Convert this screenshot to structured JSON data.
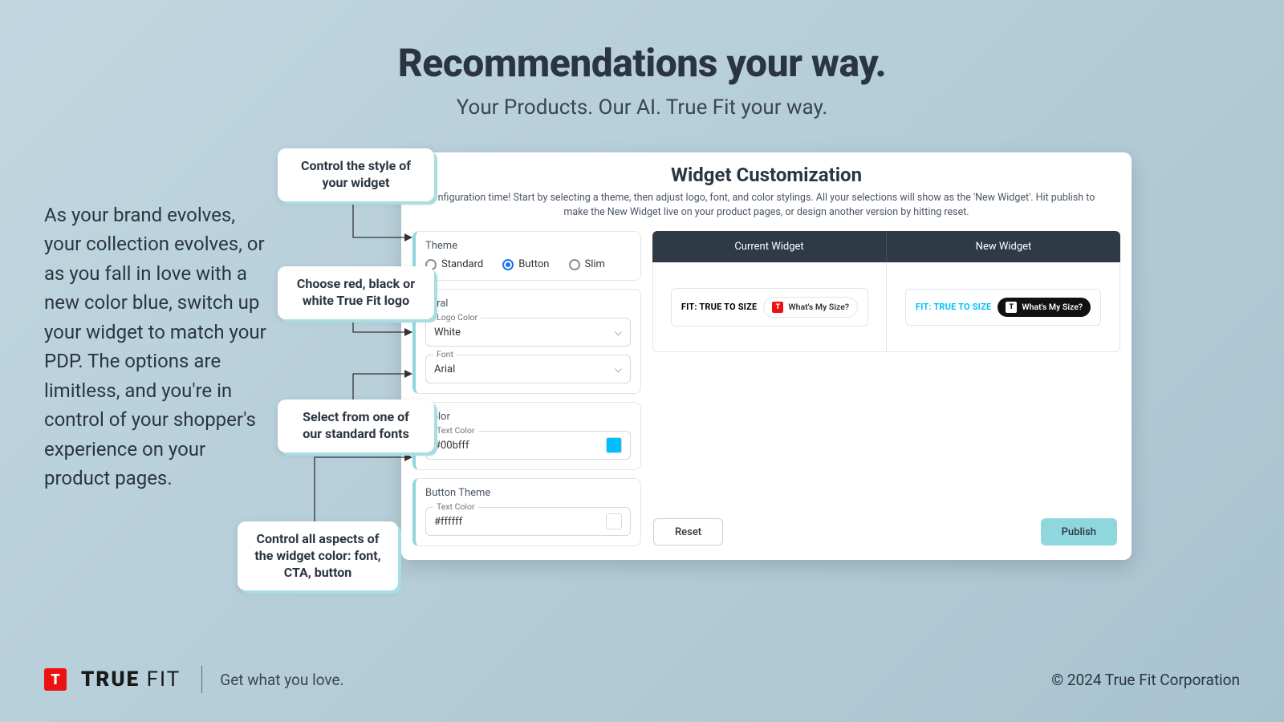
{
  "hero": {
    "title": "Recommendations your way.",
    "subtitle": "Your Products. Our AI. True Fit your way."
  },
  "body_copy": "As your brand evolves, your collection evolves, or as you fall in love with a new color blue, switch up your widget to match your PDP. The options are limitless, and you're in control of your shopper's experience on your product pages.",
  "callouts": {
    "style": "Control the style of your widget",
    "logo": "Choose red, black or white True Fit logo",
    "font": "Select from one of our standard fonts",
    "color": "Control all aspects of the widget color: font, CTA, button"
  },
  "app": {
    "title": "Widget Customization",
    "intro": "nfiguration time! Start by selecting a theme, then adjust logo, font, and color stylings. All your selections will show as the 'New Widget'. Hit publish to make the New Widget live on your product pages, or design another version by hitting reset.",
    "theme": {
      "label": "Theme",
      "options": [
        "Standard",
        "Button",
        "Slim"
      ],
      "selected": "Button"
    },
    "general": {
      "label": "neral",
      "logo_color": {
        "label": "Logo Color",
        "value": "White"
      },
      "font": {
        "label": "Font",
        "value": "Arial"
      }
    },
    "color": {
      "label": "Color",
      "text_color": {
        "label": "Text Color",
        "value": "#00bfff",
        "swatch": "#00bfff"
      }
    },
    "button_theme": {
      "label": "Button Theme",
      "text_color": {
        "label": "Text Color",
        "value": "#ffffff",
        "swatch": "#ffffff"
      }
    },
    "preview": {
      "current_label": "Current Widget",
      "new_label": "New Widget",
      "fit_text": "FIT: TRUE TO SIZE",
      "cta_text": "What's My Size?"
    },
    "actions": {
      "reset": "Reset",
      "publish": "Publish"
    }
  },
  "footer": {
    "brand_bold": "TRUE",
    "brand_light": "FIT",
    "tagline": "Get what you love.",
    "copyright": "© 2024 True Fit Corporation"
  }
}
